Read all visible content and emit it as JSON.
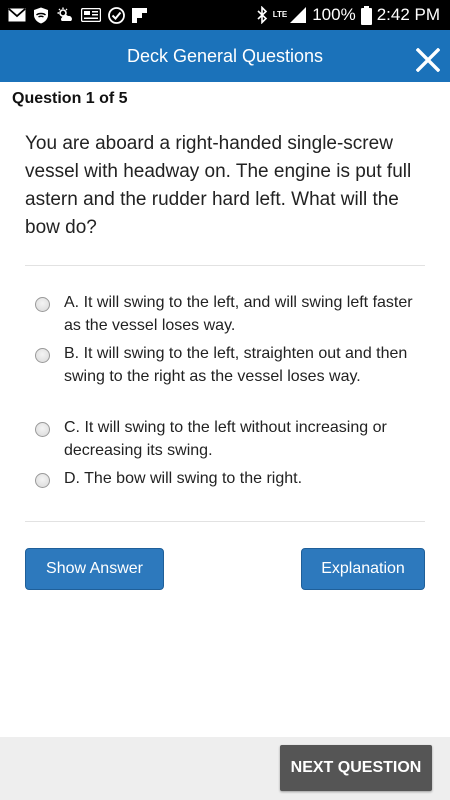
{
  "status_bar": {
    "battery": "100%",
    "time": "2:42 PM",
    "network_label": "LTE",
    "icons": [
      "mail-icon",
      "shield-icon",
      "weather-icon",
      "news-icon",
      "check-circle-icon",
      "flipboard-icon",
      "bluetooth-icon",
      "signal-icon",
      "battery-icon"
    ]
  },
  "app_bar": {
    "title": "Deck General Questions",
    "close_icon": "close-icon",
    "color": "#1b72ba"
  },
  "quiz": {
    "counter": "Question 1 of 5",
    "question": "You are aboard a right-handed single-screw vessel with headway on. The engine is put full astern and the rudder hard left. What will the bow do?",
    "choices": [
      {
        "label": "A. It will swing to the left, and will swing left faster as the vessel loses way."
      },
      {
        "label": "B. It will swing to the left, straighten out and then swing to the right as the vessel loses way."
      },
      {
        "label": "C. It will swing to the left without increasing or decreasing its swing."
      },
      {
        "label": "D. The bow will swing to the right."
      }
    ]
  },
  "actions": {
    "show_answer": "Show Answer",
    "explanation": "Explanation",
    "next_question": "NEXT QUESTION",
    "button_color": "#2d79bd"
  }
}
